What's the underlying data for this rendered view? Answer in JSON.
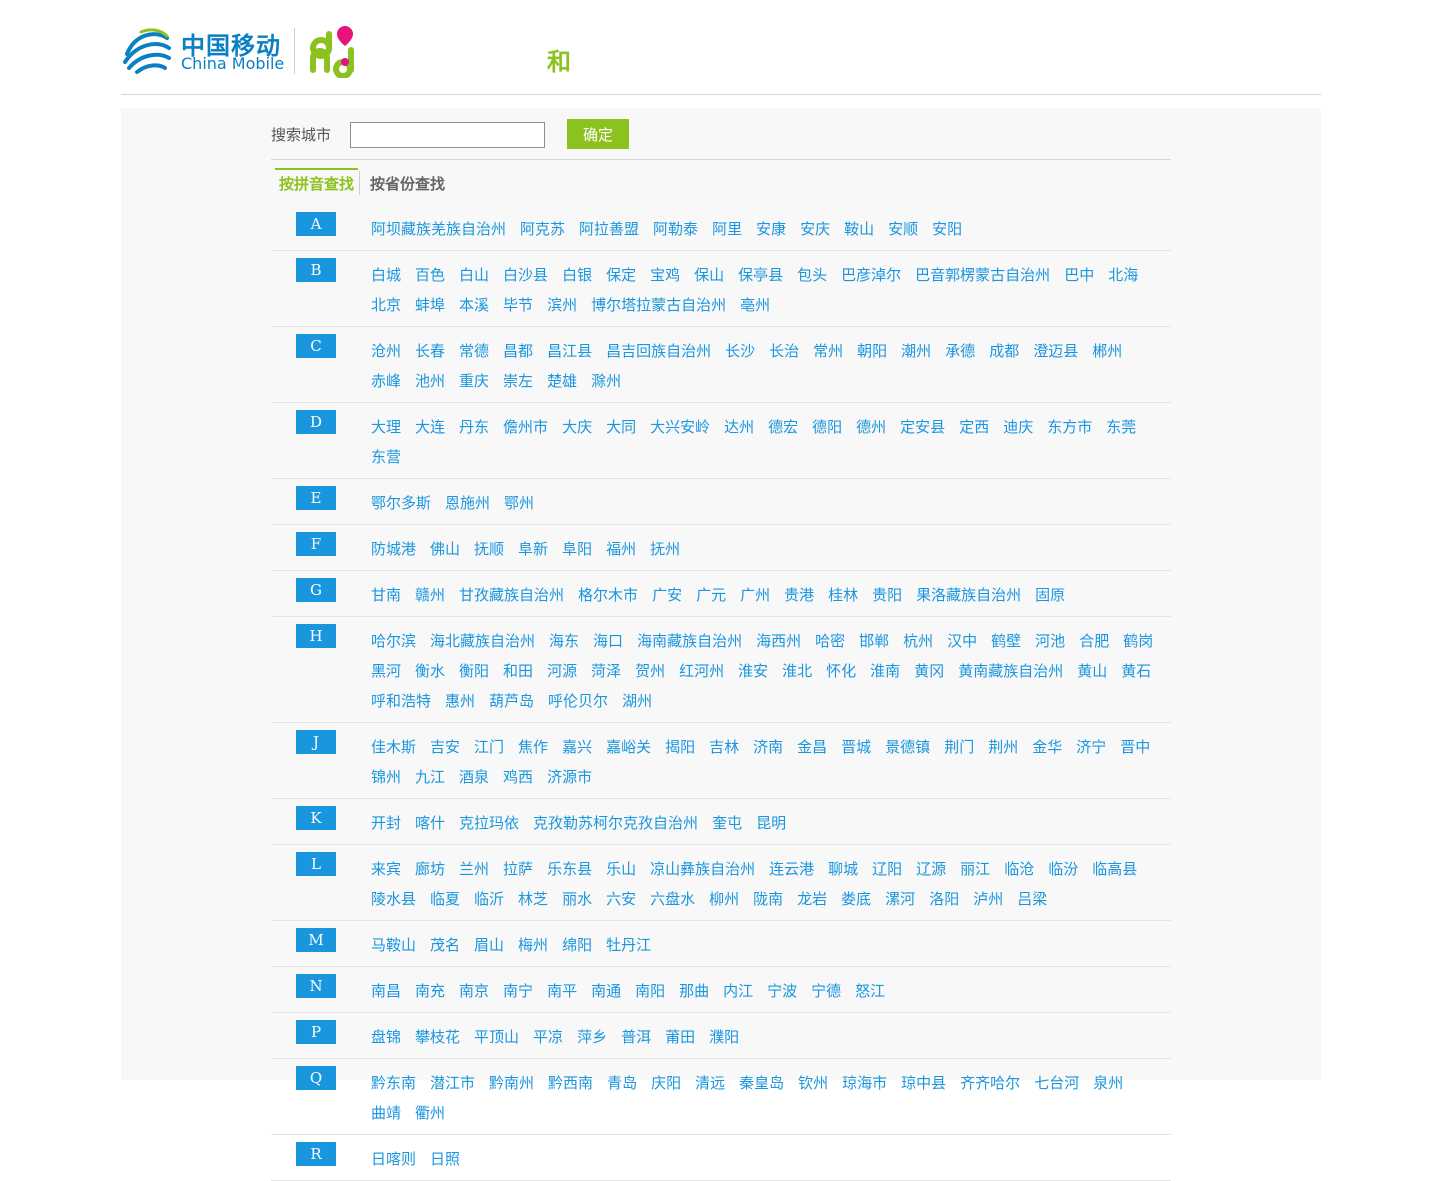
{
  "header": {
    "brand_cn": "中国移动",
    "brand_en": "China Mobile",
    "he_text": "和",
    "brand_color": "#0b7fc3",
    "accent_color": "#8cc21f"
  },
  "search": {
    "label": "搜索城市",
    "value": "",
    "placeholder": "",
    "button_label": "确定"
  },
  "tabs": [
    {
      "label": "按拼音查找",
      "active": true
    },
    {
      "label": "按省份查找",
      "active": false
    }
  ],
  "groups": [
    {
      "letter": "A",
      "cities": [
        "阿坝藏族羌族自治州",
        "阿克苏",
        "阿拉善盟",
        "阿勒泰",
        "阿里",
        "安康",
        "安庆",
        "鞍山",
        "安顺",
        "安阳"
      ]
    },
    {
      "letter": "B",
      "cities": [
        "白城",
        "百色",
        "白山",
        "白沙县",
        "白银",
        "保定",
        "宝鸡",
        "保山",
        "保亭县",
        "包头",
        "巴彦淖尔",
        "巴音郭楞蒙古自治州",
        "巴中",
        "北海",
        "北京",
        "蚌埠",
        "本溪",
        "毕节",
        "滨州",
        "博尔塔拉蒙古自治州",
        "亳州"
      ]
    },
    {
      "letter": "C",
      "cities": [
        "沧州",
        "长春",
        "常德",
        "昌都",
        "昌江县",
        "昌吉回族自治州",
        "长沙",
        "长治",
        "常州",
        "朝阳",
        "潮州",
        "承德",
        "成都",
        "澄迈县",
        "郴州",
        "赤峰",
        "池州",
        "重庆",
        "崇左",
        "楚雄",
        "滁州"
      ]
    },
    {
      "letter": "D",
      "cities": [
        "大理",
        "大连",
        "丹东",
        "儋州市",
        "大庆",
        "大同",
        "大兴安岭",
        "达州",
        "德宏",
        "德阳",
        "德州",
        "定安县",
        "定西",
        "迪庆",
        "东方市",
        "东莞",
        "东营"
      ]
    },
    {
      "letter": "E",
      "cities": [
        "鄂尔多斯",
        "恩施州",
        "鄂州"
      ]
    },
    {
      "letter": "F",
      "cities": [
        "防城港",
        "佛山",
        "抚顺",
        "阜新",
        "阜阳",
        "福州",
        "抚州"
      ]
    },
    {
      "letter": "G",
      "cities": [
        "甘南",
        "赣州",
        "甘孜藏族自治州",
        "格尔木市",
        "广安",
        "广元",
        "广州",
        "贵港",
        "桂林",
        "贵阳",
        "果洛藏族自治州",
        "固原"
      ]
    },
    {
      "letter": "H",
      "cities": [
        "哈尔滨",
        "海北藏族自治州",
        "海东",
        "海口",
        "海南藏族自治州",
        "海西州",
        "哈密",
        "邯郸",
        "杭州",
        "汉中",
        "鹤壁",
        "河池",
        "合肥",
        "鹤岗",
        "黑河",
        "衡水",
        "衡阳",
        "和田",
        "河源",
        "菏泽",
        "贺州",
        "红河州",
        "淮安",
        "淮北",
        "怀化",
        "淮南",
        "黄冈",
        "黄南藏族自治州",
        "黄山",
        "黄石",
        "呼和浩特",
        "惠州",
        "葫芦岛",
        "呼伦贝尔",
        "湖州"
      ]
    },
    {
      "letter": "J",
      "cities": [
        "佳木斯",
        "吉安",
        "江门",
        "焦作",
        "嘉兴",
        "嘉峪关",
        "揭阳",
        "吉林",
        "济南",
        "金昌",
        "晋城",
        "景德镇",
        "荆门",
        "荆州",
        "金华",
        "济宁",
        "晋中",
        "锦州",
        "九江",
        "酒泉",
        "鸡西",
        "济源市"
      ]
    },
    {
      "letter": "K",
      "cities": [
        "开封",
        "喀什",
        "克拉玛依",
        "克孜勒苏柯尔克孜自治州",
        "奎屯",
        "昆明"
      ]
    },
    {
      "letter": "L",
      "cities": [
        "来宾",
        "廊坊",
        "兰州",
        "拉萨",
        "乐东县",
        "乐山",
        "凉山彝族自治州",
        "连云港",
        "聊城",
        "辽阳",
        "辽源",
        "丽江",
        "临沧",
        "临汾",
        "临高县",
        "陵水县",
        "临夏",
        "临沂",
        "林芝",
        "丽水",
        "六安",
        "六盘水",
        "柳州",
        "陇南",
        "龙岩",
        "娄底",
        "漯河",
        "洛阳",
        "泸州",
        "吕梁"
      ]
    },
    {
      "letter": "M",
      "cities": [
        "马鞍山",
        "茂名",
        "眉山",
        "梅州",
        "绵阳",
        "牡丹江"
      ]
    },
    {
      "letter": "N",
      "cities": [
        "南昌",
        "南充",
        "南京",
        "南宁",
        "南平",
        "南通",
        "南阳",
        "那曲",
        "内江",
        "宁波",
        "宁德",
        "怒江"
      ]
    },
    {
      "letter": "P",
      "cities": [
        "盘锦",
        "攀枝花",
        "平顶山",
        "平凉",
        "萍乡",
        "普洱",
        "莆田",
        "濮阳"
      ]
    },
    {
      "letter": "Q",
      "cities": [
        "黔东南",
        "潜江市",
        "黔南州",
        "黔西南",
        "青岛",
        "庆阳",
        "清远",
        "秦皇岛",
        "钦州",
        "琼海市",
        "琼中县",
        "齐齐哈尔",
        "七台河",
        "泉州",
        "曲靖",
        "衢州"
      ]
    },
    {
      "letter": "R",
      "cities": [
        "日喀则",
        "日照"
      ]
    }
  ]
}
